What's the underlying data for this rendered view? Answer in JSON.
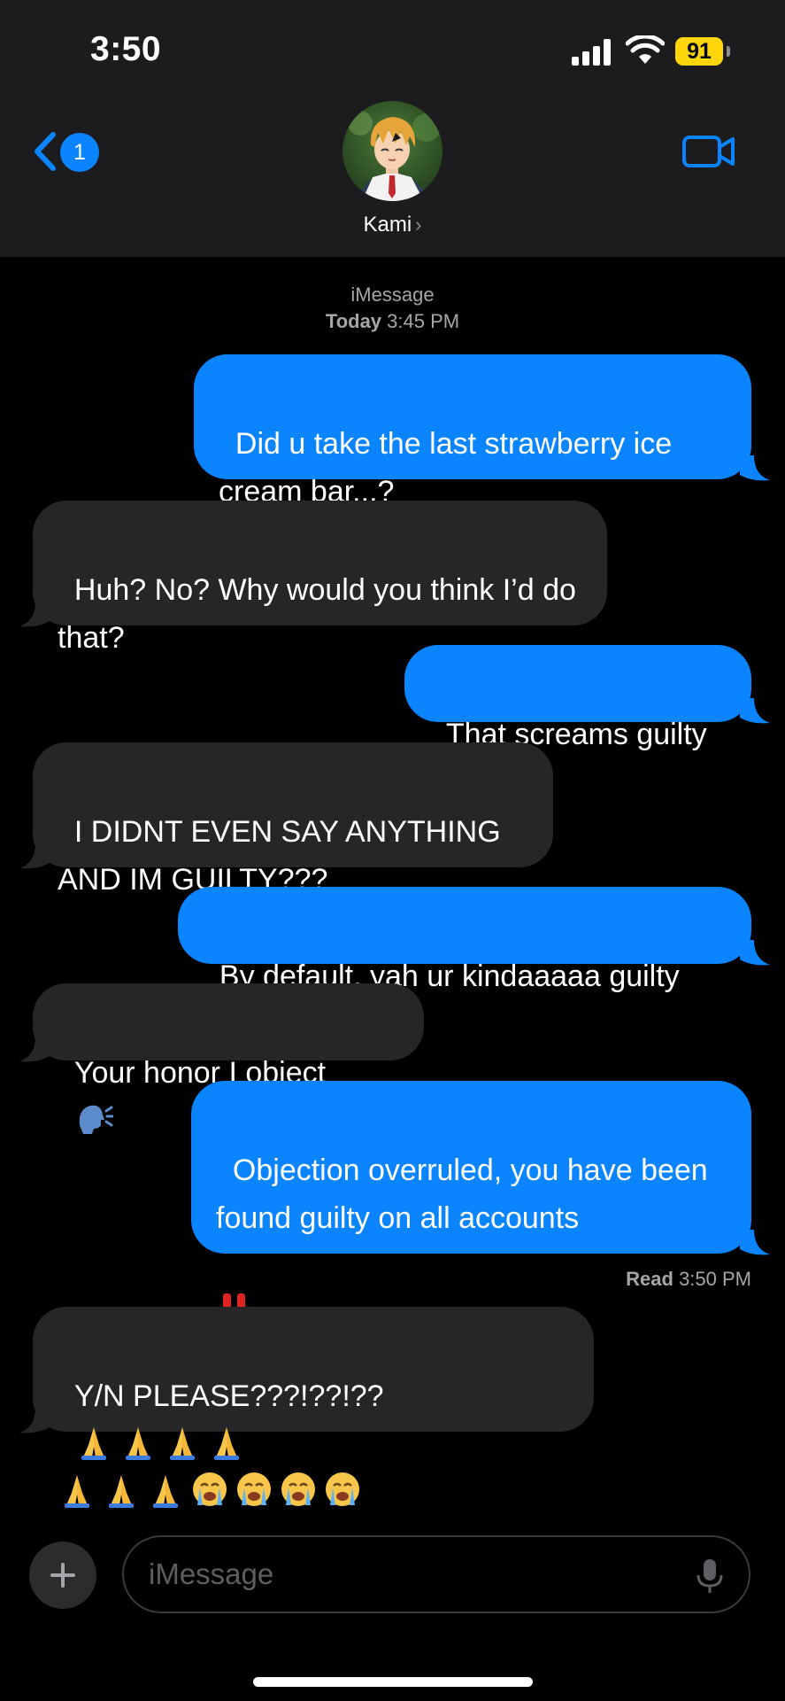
{
  "status_bar": {
    "time": "3:50",
    "battery": "91"
  },
  "header": {
    "back_badge": "1",
    "contact_name": "Kami",
    "contact_chevron": "›",
    "avatar_icon": "contact-avatar",
    "video_icon": "video-camera-icon"
  },
  "conversation": {
    "service": "iMessage",
    "date_label": "Today",
    "time_label": "3:45 PM",
    "messages": [
      {
        "from": "me",
        "text": "Did u take the last strawberry ice cream bar...?"
      },
      {
        "from": "them",
        "text": "Huh? No? Why would you think I’d do that?"
      },
      {
        "from": "me",
        "text": "That screams guilty"
      },
      {
        "from": "them",
        "text": "I DIDNT EVEN SAY ANYTHING AND IM GUILTY???"
      },
      {
        "from": "me",
        "text": "By default, yah ur kindaaaaa guilty"
      },
      {
        "from": "them",
        "text": "Your honor I object",
        "emoji": [
          "speaking-head"
        ]
      },
      {
        "from": "me",
        "text": "Objection overruled, you have been found guilty on all accounts",
        "emoji": [
          "double-exclamation"
        ]
      },
      {
        "from": "them",
        "text": "Y/N PLEASE???!??!??",
        "emoji": [
          "folded-hands",
          "folded-hands",
          "folded-hands",
          "folded-hands",
          "folded-hands",
          "folded-hands",
          "folded-hands",
          "crying-face",
          "crying-face",
          "crying-face",
          "crying-face"
        ]
      }
    ],
    "read_label": "Read",
    "read_time": "3:50 PM"
  },
  "input_bar": {
    "placeholder": "iMessage",
    "value": "",
    "plus_icon": "plus-icon",
    "mic_icon": "microphone-icon"
  },
  "colors": {
    "sent_bubble": "#0a84ff",
    "received_bubble": "#262628",
    "header_bg": "#1c1c1e",
    "battery": "#ffd60a"
  }
}
